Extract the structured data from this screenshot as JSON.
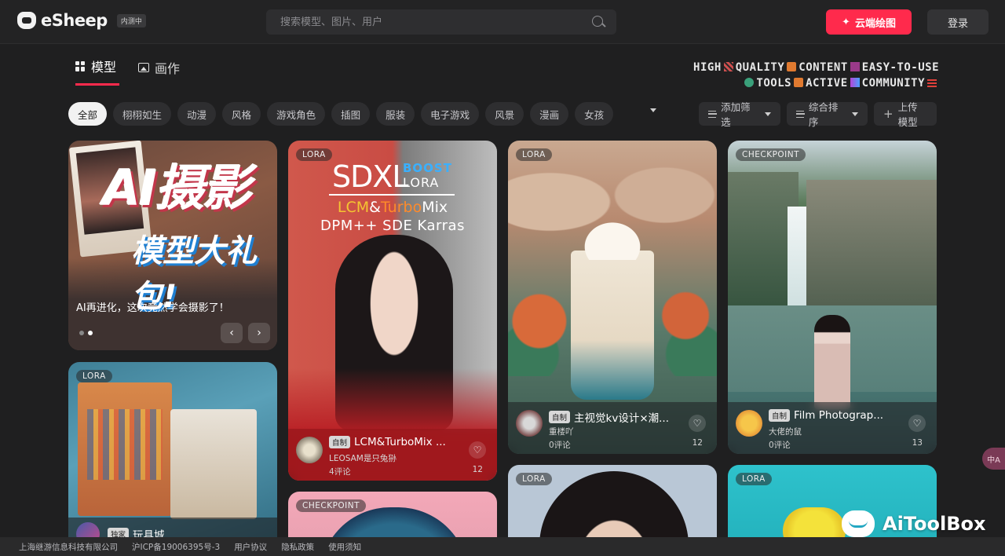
{
  "header": {
    "brand": "eSheep",
    "brand_badge": "内测中",
    "search_placeholder": "搜索模型、图片、用户",
    "cloud_button": "云端绘图",
    "login_button": "登录"
  },
  "tabs": [
    {
      "label": "模型",
      "active": true
    },
    {
      "label": "画作",
      "active": false
    }
  ],
  "slogan": {
    "line1": [
      "HIGH",
      "QUALITY",
      "CONTENT",
      "EASY-TO-USE"
    ],
    "line2": [
      "TOOLS",
      "ACTIVE",
      "COMMUNITY"
    ]
  },
  "categories": [
    "全部",
    "栩栩如生",
    "动漫",
    "风格",
    "游戏角色",
    "插图",
    "服装",
    "电子游戏",
    "风景",
    "漫画",
    "女孩"
  ],
  "filters": {
    "add_filter": "添加筛选",
    "sort": "综合排序",
    "upload": "上传模型"
  },
  "banner": {
    "title": "AI摄影",
    "subtitle": "模型大礼包!",
    "caption": "AI再进化，这次竟然学会摄影了！",
    "prev": "‹",
    "next": "›"
  },
  "cards": [
    {
      "tag": "LORA",
      "poster_title": "SDXL",
      "poster_boost": "BOOST",
      "poster_lora": "LORA",
      "poster_mix_a": "LCM",
      "poster_mix_amp": "&",
      "poster_mix_b": "Turbo",
      "poster_mix_c": "Mix",
      "poster_dpm": "DPM++ SDE Karras",
      "badge": "自制",
      "title": "LCM&TurboMix ...",
      "author": "LEOSAM是只兔狲",
      "comments": "4评论",
      "likes": "12"
    },
    {
      "tag": "LORA",
      "badge": "自制",
      "title": "主视觉kv设计×潮...",
      "author": "重楼吖",
      "comments": "0评论",
      "likes": "12"
    },
    {
      "tag": "CHECKPOINT",
      "badge": "自制",
      "title": "Film Photograp...",
      "author": "大佬的鼠",
      "comments": "0评论",
      "likes": "13"
    },
    {
      "tag": "LORA",
      "badge": "独家",
      "title": "玩具城"
    },
    {
      "tag": "CHECKPOINT"
    },
    {
      "tag": "LORA"
    },
    {
      "tag": "LORA"
    }
  ],
  "footer": [
    "上海继游信息科技有限公司",
    "沪ICP备19006395号-3",
    "用户协议",
    "隐私政策",
    "使用须知"
  ],
  "translate_label": "中A",
  "watermark": "AiToolBox",
  "colors": {
    "accent": "#ff2a4c",
    "bg": "#1f1f20"
  }
}
